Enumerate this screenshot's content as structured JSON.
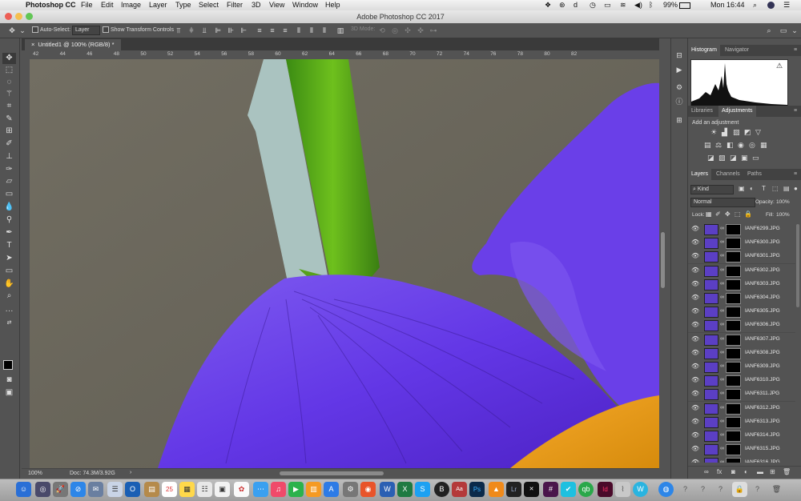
{
  "menubar": {
    "app_name": "Photoshop CC",
    "items": [
      "File",
      "Edit",
      "Image",
      "Layer",
      "Type",
      "Select",
      "Filter",
      "3D",
      "View",
      "Window",
      "Help"
    ],
    "battery": "99%",
    "clock": "Mon 16:44"
  },
  "window": {
    "title": "Adobe Photoshop CC 2017"
  },
  "options": {
    "auto_select_label": "Auto-Select:",
    "auto_select_value": "Layer",
    "transform_label": "Show Transform Controls",
    "mode_3d_label": "3D Mode:"
  },
  "document": {
    "tab_label": "Untitled1 @ 100% (RGB/8) *"
  },
  "ruler": {
    "h_ticks": [
      "42",
      "44",
      "46",
      "48",
      "50",
      "52",
      "54",
      "56",
      "58",
      "60",
      "62",
      "64",
      "66",
      "68",
      "70",
      "72",
      "74",
      "76",
      "78",
      "80",
      "82"
    ]
  },
  "status": {
    "zoom": "100%",
    "doc_size": "Doc: 74.3M/3.92G"
  },
  "panels": {
    "histogram_tabs": [
      "Histogram",
      "Navigator"
    ],
    "adjust_tabs": [
      "Libraries",
      "Adjustments"
    ],
    "adjust_title": "Add an adjustment",
    "layer_tabs": [
      "Layers",
      "Channels",
      "Paths"
    ],
    "kind_label": "Kind",
    "blend_mode": "Normal",
    "opacity_label": "Opacity:",
    "opacity_value": "100%",
    "lock_label": "Lock:",
    "fill_label": "Fill:",
    "fill_value": "100%"
  },
  "layers": [
    "IANF6299.JPG",
    "IANF6300.JPG",
    "IANF6301.JPG",
    "IANF6302.JPG",
    "IANF6303.JPG",
    "IANF6304.JPG",
    "IANF6305.JPG",
    "IANF6306.JPG",
    "IANF6307.JPG",
    "IANF6308.JPG",
    "IANF6309.JPG",
    "IANF6310.JPG",
    "IANF6311.JPG",
    "IANF6312.JPG",
    "IANF6313.JPG",
    "IANF6314.JPG",
    "IANF6315.JPG",
    "IANF6316.JPG"
  ],
  "dock_badges": {
    "calendar_day": "25"
  }
}
